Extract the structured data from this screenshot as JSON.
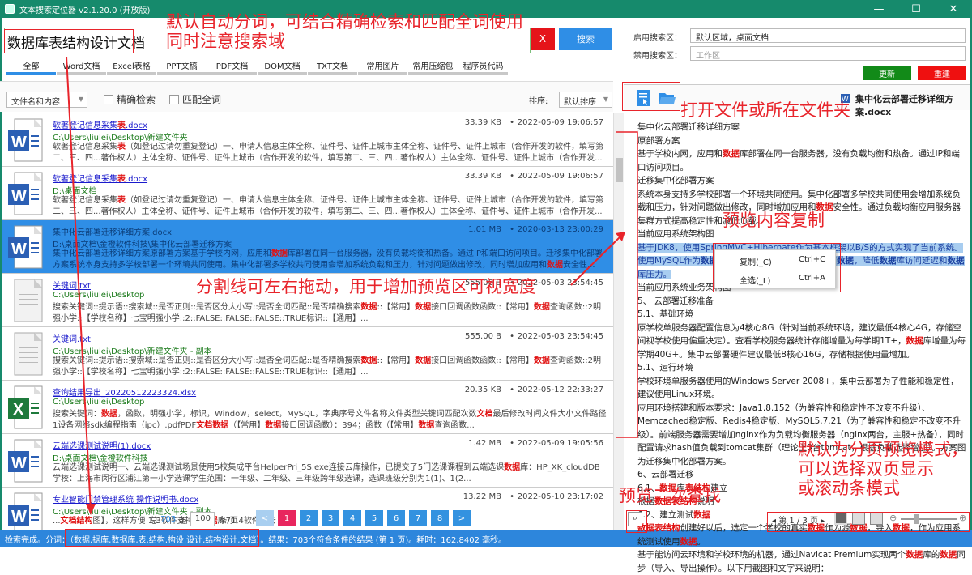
{
  "window": {
    "title": "文本搜索定位器 v2.1.20.0 (开放版)",
    "minimize": "—",
    "maximize": "☐",
    "close": "✕"
  },
  "search": {
    "value": "数据库表结构设计文档",
    "clear_label": "X",
    "search_label": "搜索"
  },
  "tabs": [
    "全部",
    "Word文档",
    "Excel表格",
    "PPT文稿",
    "PDF文档",
    "DOM文档",
    "TXT文档",
    "常用图片",
    "常用压缩包",
    "程序员代码"
  ],
  "options": {
    "scope": "文件名和内容",
    "exact": "精确检索",
    "whole_word": "匹配全词",
    "sort_label": "排序:",
    "sort_value": "默认排序"
  },
  "results": [
    {
      "type": "word",
      "name": [
        {
          "t": "软著登记信息采集"
        },
        {
          "t": "表",
          "h": 1
        },
        {
          "t": ".docx"
        }
      ],
      "path": "C:\\Users\\liulei\\Desktop\\新建文件夹",
      "size": "33.39 KB",
      "date": "2022-05-09 19:06:57",
      "snippet": [
        {
          "t": "软著登记信息采集"
        },
        {
          "t": "表",
          "h": 1
        },
        {
          "t": "（如登记过请勿重复登记）一、申请人信息主体全称、证件号、证件上城市主体全称、证件号、证件上城市（合作开发的软件，填写第二、三、四...著作权人）主体全称、证件号、证件上城市（合作开发的软件，填写第二、三、四...著作权人）主体全称、证件号、证件上城市（合作开发..."
        }
      ]
    },
    {
      "type": "word",
      "name": [
        {
          "t": "软著登记信息采集"
        },
        {
          "t": "表",
          "h": 1
        },
        {
          "t": ".docx"
        }
      ],
      "path": "D:\\桌面文档",
      "size": "33.39 KB",
      "date": "2022-05-09 19:06:57",
      "snippet": [
        {
          "t": "软著登记信息采集"
        },
        {
          "t": "表",
          "h": 1
        },
        {
          "t": "（如登记过请勿重复登记）一、申请人信息主体全称、证件号、证件上城市主体全称、证件号、证件上城市（合作开发的软件，填写第二、三、四...著作权人）主体全称、证件号、证件上城市（合作开发的软件，填写第二、三、四...著作权人）主体全称、证件号、证件上城市（合作开发..."
        }
      ]
    },
    {
      "type": "word",
      "selected": true,
      "name": [
        {
          "t": "集中化云部署迁移详细方案.docx"
        }
      ],
      "path": "D:\\桌面文档\\金橙软件科技\\集中化云部署迁移方案",
      "size": "1.01 MB",
      "date": "2020-03-13 23:00:29",
      "snippet": [
        {
          "t": "集中化云部署迁移详细方案原部署方案基于学校内网，应用和"
        },
        {
          "t": "数据",
          "h": 1
        },
        {
          "t": "库部署在同一台服务器，没有负载均衡和热备。通过IP和端口访问项目。迁移集中化部署方案系统本身支持多学校部署一个环境共同使用。集中化部署多学校共同使用会增加系统负载和压力，针对问题做出修改，同时增加应用和"
        },
        {
          "t": "数据",
          "h": 1
        },
        {
          "t": "安全性..."
        }
      ]
    },
    {
      "type": "txt",
      "name": [
        {
          "t": "关键词.txt"
        }
      ],
      "path": "C:\\Users\\liulei\\Desktop",
      "size": "555.00 B",
      "date": "2022-05-03 23:54:45",
      "snippet": [
        {
          "t": "搜索关键词::提示语::搜索域::是否正则::是否区分大小写::是否全词匹配::是否精确搜索"
        },
        {
          "t": "数据",
          "h": 1
        },
        {
          "t": "::【常用】"
        },
        {
          "t": "数据",
          "h": 1
        },
        {
          "t": "接口回调函数函数::【常用】"
        },
        {
          "t": "数据",
          "h": 1
        },
        {
          "t": "查询函数::2明强小学::【学校名称】七宝明强小学::2::FALSE::FALSE::FALSE::TRUE标识::【通用】..."
        }
      ]
    },
    {
      "type": "txt",
      "name": [
        {
          "t": "关键词.txt"
        }
      ],
      "path": "C:\\Users\\liulei\\Desktop\\新建文件夹 - 副本",
      "size": "555.00 B",
      "date": "2022-05-03 23:54:45",
      "snippet": [
        {
          "t": "搜索关键词::提示语::搜索域::是否正则::是否区分大小写::是否全词匹配::是否精确搜索"
        },
        {
          "t": "数据",
          "h": 1
        },
        {
          "t": "::【常用】"
        },
        {
          "t": "数据",
          "h": 1
        },
        {
          "t": "接口回调函数函数::【常用】"
        },
        {
          "t": "数据",
          "h": 1
        },
        {
          "t": "查询函数::2明强小学::【学校名称】七宝明强小学::2::FALSE::FALSE::FALSE::TRUE标识::【通用】..."
        }
      ]
    },
    {
      "type": "excel",
      "name": [
        {
          "t": "查询结果导出_20220512223324.xlsx"
        }
      ],
      "path": "C:\\Users\\liulei\\Desktop",
      "size": "20.35 KB",
      "date": "2022-05-12 22:33:27",
      "snippet": [
        {
          "t": "搜索关键词："
        },
        {
          "t": "数据",
          "h": 1
        },
        {
          "t": "，函数，明强小学，标识，Window，select，MySQL，字典序号文件名称文件类型关键词匹配次数"
        },
        {
          "t": "文档",
          "h": 1
        },
        {
          "t": "最后修改时间文件大小文件路径1设备网络sdk编程指南（ipc）.pdfPDF"
        },
        {
          "t": "文档数据",
          "h": 1
        },
        {
          "t": "（【常用】"
        },
        {
          "t": "数据",
          "h": 1
        },
        {
          "t": "接口回调函数）：394；函数（【常用】"
        },
        {
          "t": "数据",
          "h": 1
        },
        {
          "t": "查询函数..."
        }
      ]
    },
    {
      "type": "word",
      "name": [
        {
          "t": "云端选课测试说明(1).docx"
        }
      ],
      "path": "D:\\桌面文档\\金橙软件科技",
      "size": "1.42 MB",
      "date": "2022-05-09 19:05:56",
      "snippet": [
        {
          "t": "云端选课测试说明一、云端选课测试场景使用5校集成平台HelperPri_5S.exe连接云库操作，已提交了5门选课课程到云端选课"
        },
        {
          "t": "数据",
          "h": 1
        },
        {
          "t": "库：HP_XK_cloudDB学校：上海市闵行区浦江第一小学选课学生范围：一年级、二年级、三年级跨年级选课，选课班级分别为1(1)、1(2..."
        }
      ]
    },
    {
      "type": "word",
      "name": [
        {
          "t": "专业智能门禁管理系统 操作说明书.docx"
        }
      ],
      "path": "C:\\Users\\liulei\\Desktop\\新建文件夹 - 副本",
      "size": "13.22 MB",
      "date": "2022-05-10 23:17:02",
      "snippet": [
        {
          "t": "..."
        },
        {
          "t": "文档结构",
          "h": 1
        },
        {
          "t": "图】，这样方便                                                                                  1.3软件支持的"
        },
        {
          "t": "数据",
          "h": 1
        },
        {
          "t": "库71.4软件的安"
        }
      ]
    }
  ],
  "pagination": {
    "total_prefix": "总",
    "total": "703",
    "total_suffix": "条",
    "page_size": "100",
    "page_size_suffix": "条/页",
    "prev": "<",
    "next": ">",
    "pages": [
      "1",
      "2",
      "3",
      "4",
      "5",
      "6",
      "7",
      "8"
    ],
    "current": "1"
  },
  "status": "检索完成。分词：（数据,据库,数据库,表,结构,构设,设计,结构设计,文档）。结果：703个符合条件的结果 (第 1 页)。耗时：162.8402 毫秒。",
  "scope": {
    "enable_label": "启用搜索区：",
    "enable_value": "默认区域，桌面文档",
    "disable_label": "禁用搜索区：",
    "disable_placeholder": "工作区",
    "update_label": "更新",
    "rebuild_label": "重建"
  },
  "preview": {
    "file_name": "集中化云部署迁移详细方案.docx",
    "lines": [
      [
        {
          "t": "集中化云部署迁移详细方案"
        }
      ],
      [
        {
          "t": "原部署方案"
        }
      ],
      [
        {
          "t": " "
        }
      ],
      [
        {
          "t": "基于学校内网，应用和"
        },
        {
          "t": "数据",
          "h": 1
        },
        {
          "t": "库部署在同一台服务器，没有负载均衡和热备。通过IP和端口访问项目。"
        }
      ],
      [
        {
          "t": "迁移集中化部署方案"
        }
      ],
      [
        {
          "t": " "
        }
      ],
      [
        {
          "t": "系统本身支持多学校部署一个环境共同使用。集中化部署多学校共同使用会增加系统负载和压力，针对问题做出修改，同时增加应用和"
        },
        {
          "t": "数据",
          "h": 1
        },
        {
          "t": "安全性。通过负载均衡应用服务器集群方式提高稳定性和减低负载。"
        }
      ],
      [
        {
          "t": "当前应用系统架构图"
        }
      ],
      [
        {
          "t": " "
        }
      ],
      [
        {
          "t": "基于JDK8，使用SpringMVC+Hibernate作为基本框架以B/S的方式实现了当前系统。使用MySQL作为",
          "s": 1
        },
        {
          "t": "数据",
          "h": 1,
          "s": 1
        },
        {
          "t": "层",
          "s": 1
        },
        {
          "t": "数据",
          "h": 1,
          "s": 1
        },
        {
          "t": "库，应用服务器直接读写",
          "s": 1
        },
        {
          "t": "数据",
          "h": 1,
          "s": 1
        },
        {
          "t": "，降低",
          "s": 1
        },
        {
          "t": "数据",
          "h": 1,
          "s": 1
        },
        {
          "t": "库访问延迟和",
          "s": 1
        },
        {
          "t": "数据",
          "h": 1,
          "s": 1
        },
        {
          "t": "库压力。",
          "s": 1
        }
      ],
      [
        {
          "t": "当前应用系统业务架构图"
        }
      ],
      [
        {
          "t": " "
        }
      ],
      [
        {
          "t": "5、 云部署迁移准备"
        }
      ],
      [
        {
          "t": "5.1、基础环境"
        }
      ],
      [
        {
          "t": "原学校单服务器配置信息为4核心8G（针对当前系统环境，建议最低4核心4G，存储空间视学校使用偏重决定）。查看学校服务器统计存储增量为每学期1T+，"
        },
        {
          "t": "数据",
          "h": 1
        },
        {
          "t": "库增量为每学期40G+。集中云部署硬件建议最低8核心16G，存储根据使用量增加。"
        }
      ],
      [
        {
          "t": "5.1、运行环境"
        }
      ],
      [
        {
          "t": "学校环境单服务器使用的Windows Server 2008+，集中云部署为了性能和稳定性，建议使用Linux环境。"
        }
      ],
      [
        {
          "t": "应用环境搭建和版本要求：Java1.8.152（为兼容性和稳定性不改变不升级）、Memcached稳定版、Redis4稳定版、MySQL5.7.21（为了兼容性和稳定不改变不升级）。前端服务器需要增加nginx作为负载均衡服务器（nginx两台，主服+热备），同时配置请求hash值负载到tomcat集群（理论上3台tomcat，根据负载选择增加）。方案图为迁移集中化部署方案。"
        }
      ],
      [
        {
          "t": "6、云部署迁移"
        }
      ],
      [
        {
          "t": "6.1、"
        },
        {
          "t": "数据",
          "h": 1
        },
        {
          "t": "库"
        },
        {
          "t": "表结构",
          "h": 1
        },
        {
          "t": "建立"
        }
      ],
      [
        {
          "t": "根据"
        },
        {
          "t": "数据表结构",
          "h": 1
        },
        {
          "t": "说明"
        }
      ],
      [
        {
          "t": "6.2、建立测试"
        },
        {
          "t": "数据",
          "h": 1
        }
      ],
      [
        {
          "t": "数据表结构",
          "h": 1
        },
        {
          "t": "创建好以后，选定一个学校的真实"
        },
        {
          "t": "数据",
          "h": 1
        },
        {
          "t": "作为源"
        },
        {
          "t": "数据",
          "h": 1
        },
        {
          "t": "，导入"
        },
        {
          "t": "数据",
          "h": 1
        },
        {
          "t": "，作为应用系统测试使用"
        },
        {
          "t": "数据",
          "h": 1
        },
        {
          "t": "。"
        }
      ],
      [
        {
          "t": "基于能访问云环境和学校环境的机器，通过Navicat Premium实现两个"
        },
        {
          "t": "数据",
          "h": 1
        },
        {
          "t": "库的"
        },
        {
          "t": "数据",
          "h": 1
        },
        {
          "t": "同步（导入、导出操作）。以下用截图和文字来说明："
        }
      ]
    ],
    "context_menu": [
      {
        "label": "复制(_C)",
        "shortcut": "Ctrl+C"
      },
      {
        "label": "全选(_L)",
        "shortcut": "Ctrl+A"
      }
    ],
    "page_info": "◂ 第 1 / 3 页 ▸"
  },
  "annotations": {
    "a1": "默认自动分词，可结合精确检索和匹配全词使用\n同时注意搜索域",
    "a2": "打开文件或所在文件夹",
    "a3": "预览内容复制",
    "a4": "分割线可左右拖动，用于增加预览区可视宽度",
    "a5": "预览二次查找",
    "a6": "默认为分页预览模式，\n可以选择双页显示\n或滚动条模式"
  },
  "colors": {
    "titlebar": "#168a6c",
    "accent": "#2f8ee6",
    "highlight": "#e01010",
    "annotation": "#e8242b",
    "current_page": "#e8265e"
  }
}
